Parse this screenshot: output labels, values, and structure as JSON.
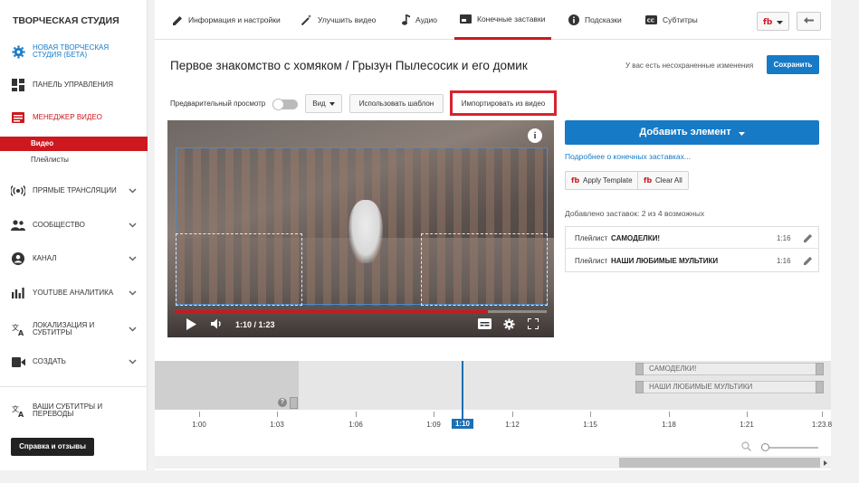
{
  "sidebar": {
    "title": "ТВОРЧЕСКАЯ СТУДИЯ",
    "items": [
      {
        "label": "НОВАЯ ТВОРЧЕСКАЯ СТУДИЯ (БЕТА)",
        "icon": "gear-icon"
      },
      {
        "label": "ПАНЕЛЬ УПРАВЛЕНИЯ",
        "icon": "dashboard-icon"
      },
      {
        "label": "МЕНЕДЖЕР ВИДЕО",
        "icon": "video-manager-icon"
      },
      {
        "label": "ПРЯМЫЕ ТРАНСЛЯЦИИ",
        "icon": "live-icon"
      },
      {
        "label": "СООБЩЕСТВО",
        "icon": "community-icon"
      },
      {
        "label": "КАНАЛ",
        "icon": "channel-icon"
      },
      {
        "label": "YOUTUBE АНАЛИТИКА",
        "icon": "analytics-icon"
      },
      {
        "label": "ЛОКАЛИЗАЦИЯ И СУБТИТРЫ",
        "icon": "translate-icon"
      },
      {
        "label": "СОЗДАТЬ",
        "icon": "create-icon"
      },
      {
        "label": "ВАШИ СУБТИТРЫ И ПЕРЕВОДЫ",
        "icon": "translate-icon"
      }
    ],
    "sub_items": [
      "Видео",
      "Плейлисты"
    ],
    "help_label": "Справка и отзывы"
  },
  "tabs": [
    {
      "label": "Информация и настройки",
      "icon": "pencil-icon"
    },
    {
      "label": "Улучшить видео",
      "icon": "magic-wand-icon"
    },
    {
      "label": "Аудио",
      "icon": "music-note-icon"
    },
    {
      "label": "Конечные заставки",
      "icon": "end-screen-icon"
    },
    {
      "label": "Подсказки",
      "icon": "info-icon"
    },
    {
      "label": "Субтитры",
      "icon": "cc-icon"
    }
  ],
  "header": {
    "video_title": "Первое знакомство с хомяком / Грызун Пылесосик и его домик",
    "unsaved_text": "У вас есть несохраненные изменения",
    "save_label": "Сохранить"
  },
  "toolbar": {
    "preview_label": "Предварительный просмотр",
    "preview_on": false,
    "view_label": "Вид",
    "use_template_label": "Использовать шаблон",
    "import_label": "Импортировать из видео"
  },
  "player": {
    "time_display": "1:10 / 1:23",
    "progress": 0.843
  },
  "panel": {
    "add_element_label": "Добавить элемент",
    "learn_more": "Подробнее о конечных заставках...",
    "apply_template": "Apply Template",
    "clear_all": "Clear All",
    "count_text": "Добавлено заставок: 2 из 4 возможных",
    "elements": [
      {
        "kind": "Плейлист",
        "name": "САМОДЕЛКИ!",
        "duration": "1:16"
      },
      {
        "kind": "Плейлист",
        "name": "НАШИ ЛЮБИМЫЕ МУЛЬТИКИ",
        "duration": "1:16"
      }
    ]
  },
  "timeline": {
    "tracks": [
      "САМОДЕЛКИ!",
      "НАШИ ЛЮБИМЫЕ МУЛЬТИКИ"
    ],
    "ticks": [
      "1:00",
      "1:03",
      "1:06",
      "1:09",
      "1:12",
      "1:15",
      "1:18",
      "1:21",
      "1:23.8"
    ],
    "playhead_label": "1:10",
    "help_mark": "?"
  },
  "colors": {
    "accent_red": "#cc181e",
    "accent_blue": "#167ac6",
    "highlight_red": "#d9232f"
  }
}
